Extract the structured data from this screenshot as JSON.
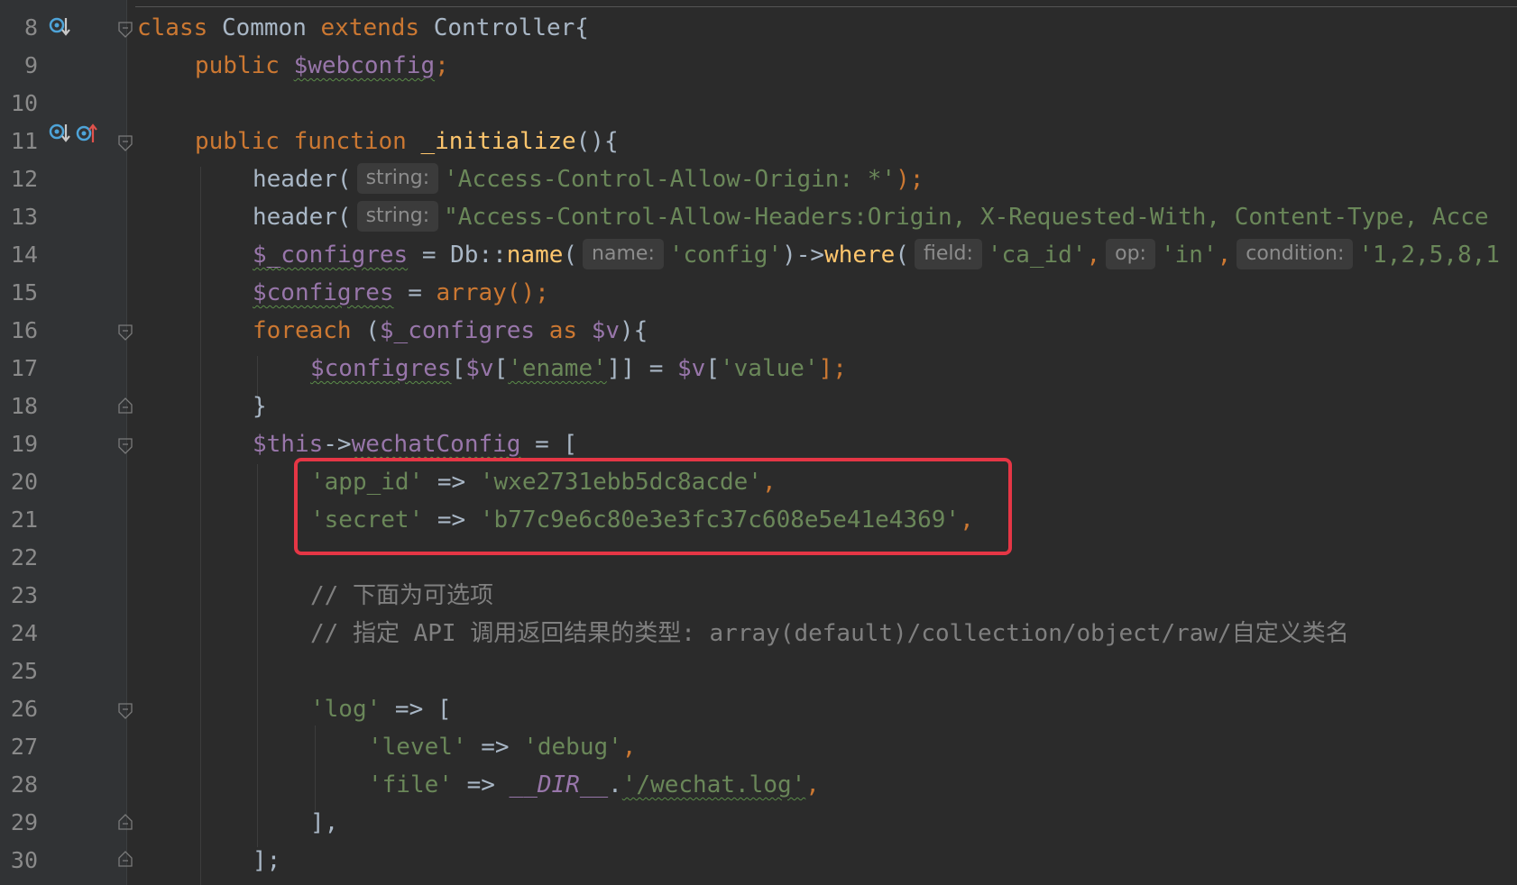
{
  "editor": {
    "line_numbers": [
      "8",
      "9",
      "10",
      "11",
      "12",
      "13",
      "14",
      "15",
      "16",
      "17",
      "18",
      "19",
      "20",
      "21",
      "22",
      "23",
      "24",
      "25",
      "26",
      "27",
      "28",
      "29",
      "30"
    ],
    "line8": {
      "kw_class": "class",
      "name": "Common",
      "kw_extends": "extends",
      "parent": "Controller{"
    },
    "line9": {
      "kw": "public",
      "var": "$webconfig",
      "end": ";"
    },
    "line11": {
      "kw1": "public",
      "kw2": "function",
      "fn": "_initialize",
      "end": "(){"
    },
    "line12": {
      "call": "header(",
      "hint": "string:",
      "str": "'Access-Control-Allow-Origin: *'",
      "end": ");"
    },
    "line13": {
      "call": "header(",
      "hint": "string:",
      "str": "\"Access-Control-Allow-Headers:Origin, X-Requested-With, Content-Type, Acce"
    },
    "line14": {
      "var": "$_configres",
      "op": " = Db::",
      "fn1": "name",
      "p1": "(",
      "hint1": "name:",
      "s1": "'config'",
      "arrow": ")->",
      "fn2": "where",
      "p2": "(",
      "hint2": "field:",
      "s2": "'ca_id'",
      "c1": ",",
      "hint3": "op:",
      "s3": "'in'",
      "c2": ",",
      "hint4": "condition:",
      "s4": "'1,2,5,8,1"
    },
    "line15": {
      "var": "$configres",
      "op": " = ",
      "kw": "array",
      "end": "();"
    },
    "line16": {
      "kw": "foreach",
      "p": " (",
      "v1": "$_configres",
      "as": " as ",
      "v2": "$v",
      "end": "){"
    },
    "line17": {
      "v1": "$configres",
      "b1": "[",
      "v2": "$v",
      "b2": "[",
      "s1": "'ename'",
      "b3": "]] = ",
      "v3": "$v",
      "b4": "[",
      "s2": "'value'",
      "end": "];"
    },
    "line18": {
      "text": "}"
    },
    "line19": {
      "v": "$this",
      "arrow": "->",
      "prop": "wechatConfig",
      "end": " = ["
    },
    "line20": {
      "key": "'app_id'",
      "arrow": " => ",
      "val": "'wxe2731ebb5dc8acde'",
      "end": ","
    },
    "line21": {
      "key": "'secret'",
      "arrow": " => ",
      "val": "'b77c9e6c80e3e3fc37c608e5e41e4369'",
      "end": ","
    },
    "line23": {
      "text": "// 下面为可选项"
    },
    "line24": {
      "text": "// 指定 API 调用返回结果的类型: array(default)/collection/object/raw/自定义类名"
    },
    "line26": {
      "key": "'log'",
      "end": " => ["
    },
    "line27": {
      "key": "'level'",
      "arrow": " => ",
      "val": "'debug'",
      "end": ","
    },
    "line28": {
      "key": "'file'",
      "arrow": " => ",
      "dir": "__DIR__",
      "dot": ".",
      "val": "'/wechat.log'",
      "end": ","
    },
    "line29": {
      "text": "],"
    },
    "line30": {
      "text": "];"
    }
  },
  "colors": {
    "background": "#2b2b2b",
    "highlight_box": "#e53645",
    "keyword": "#cc7832",
    "string": "#6a8759",
    "variable": "#9876aa",
    "function": "#ffc66d"
  }
}
